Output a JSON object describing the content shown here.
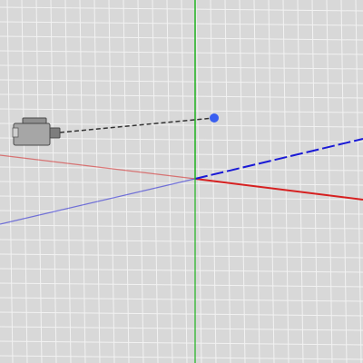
{
  "viewport": {
    "background_color": "#d8d8d8",
    "grid_color": "#f2f2f2",
    "grid_visible": true
  },
  "axes": {
    "x": {
      "color": "#d62020",
      "icon": "x-axis-line"
    },
    "y": {
      "color": "#1fb31f",
      "icon": "y-axis-line"
    },
    "z": {
      "color": "#1a1ad6",
      "icon": "z-axis-line"
    }
  },
  "camera": {
    "icon": "camera-gizmo-icon",
    "body_color": "#a6a6a6"
  },
  "camera_target": {
    "icon": "camera-target-point",
    "color": "#3a5ff0"
  },
  "view_line": {
    "style": "dashed",
    "color": "#333333"
  }
}
